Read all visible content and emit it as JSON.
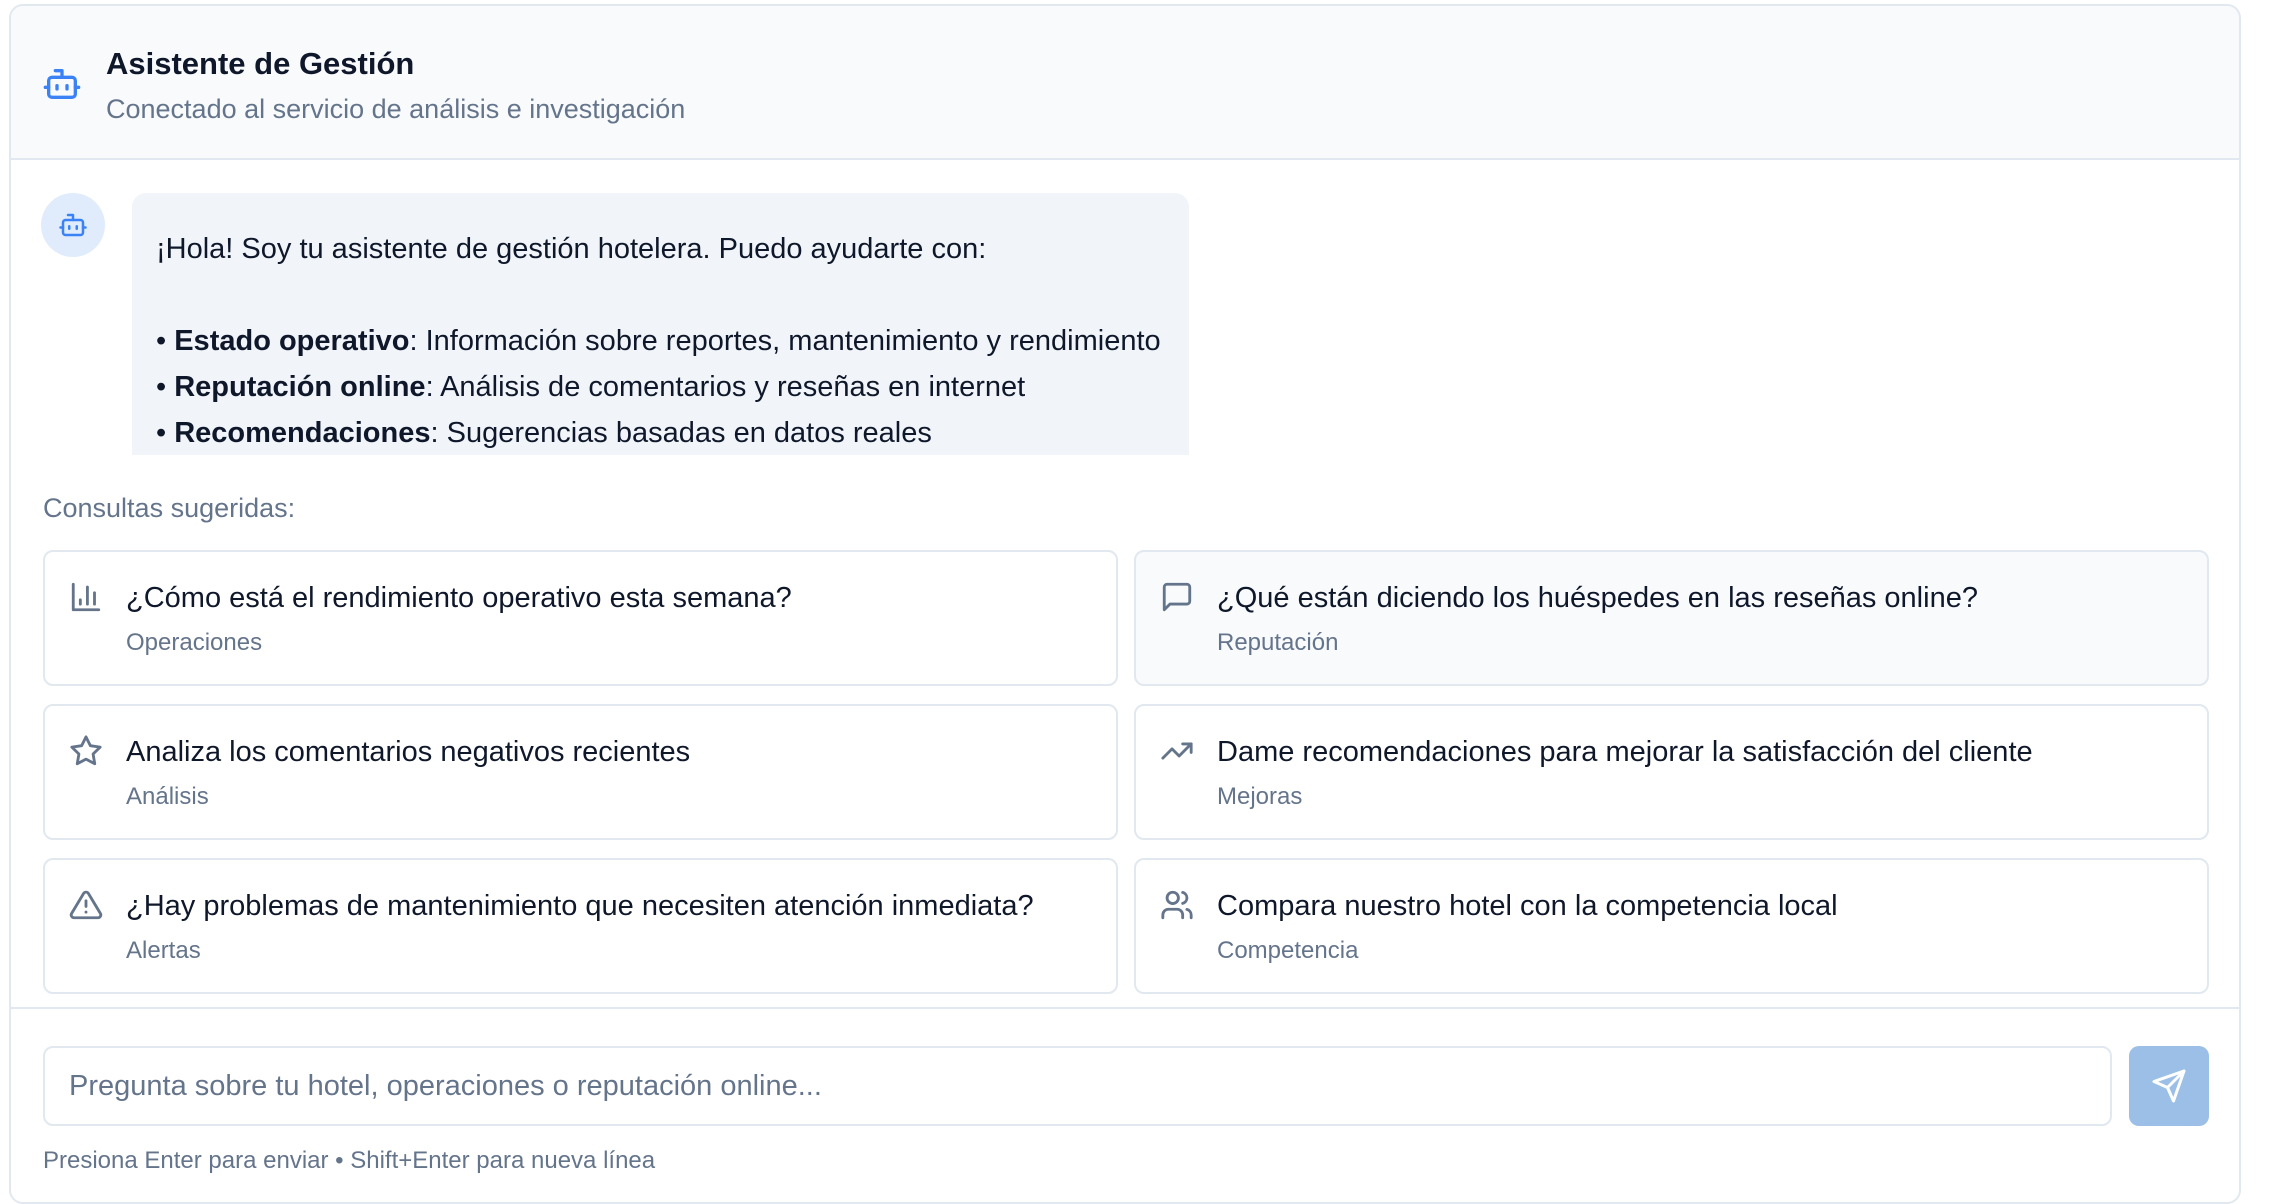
{
  "header": {
    "title": "Asistente de Gestión",
    "subtitle": "Conectado al servicio de análisis e investigación",
    "icon": "bot-icon"
  },
  "message": {
    "intro": "¡Hola! Soy tu asistente de gestión hotelera. Puedo ayudarte con:",
    "items": [
      {
        "bullet": "• ",
        "bold": "Estado operativo",
        "rest": ": Información sobre reportes, mantenimiento y rendimiento"
      },
      {
        "bullet": "• ",
        "bold": "Reputación online",
        "rest": ": Análisis de comentarios y reseñas en internet"
      },
      {
        "bullet": "• ",
        "bold": "Recomendaciones",
        "rest": ": Sugerencias basadas en datos reales"
      }
    ]
  },
  "suggestions": {
    "label": "Consultas sugeridas:",
    "cards": [
      {
        "text": "¿Cómo está el rendimiento operativo esta semana?",
        "category": "Operaciones",
        "icon": "bar-chart-icon"
      },
      {
        "text": "¿Qué están diciendo los huéspedes en las reseñas online?",
        "category": "Reputación",
        "icon": "message-square-icon"
      },
      {
        "text": "Analiza los comentarios negativos recientes",
        "category": "Análisis",
        "icon": "star-icon"
      },
      {
        "text": "Dame recomendaciones para mejorar la satisfacción del cliente",
        "category": "Mejoras",
        "icon": "trending-up-icon"
      },
      {
        "text": "¿Hay problemas de mantenimiento que necesiten atención inmediata?",
        "category": "Alertas",
        "icon": "alert-triangle-icon"
      },
      {
        "text": "Compara nuestro hotel con la competencia local",
        "category": "Competencia",
        "icon": "users-icon"
      }
    ]
  },
  "composer": {
    "placeholder": "Pregunta sobre tu hotel, operaciones o reputación online...",
    "value": "",
    "hint": "Presiona Enter para enviar • Shift+Enter para nueva línea",
    "send_icon": "send-icon"
  },
  "colors": {
    "accent": "#3b82f6",
    "send_button": "#9bbfe6",
    "bubble": "#f1f5f9",
    "border": "#e2e8f0",
    "muted_text": "#64748b"
  }
}
